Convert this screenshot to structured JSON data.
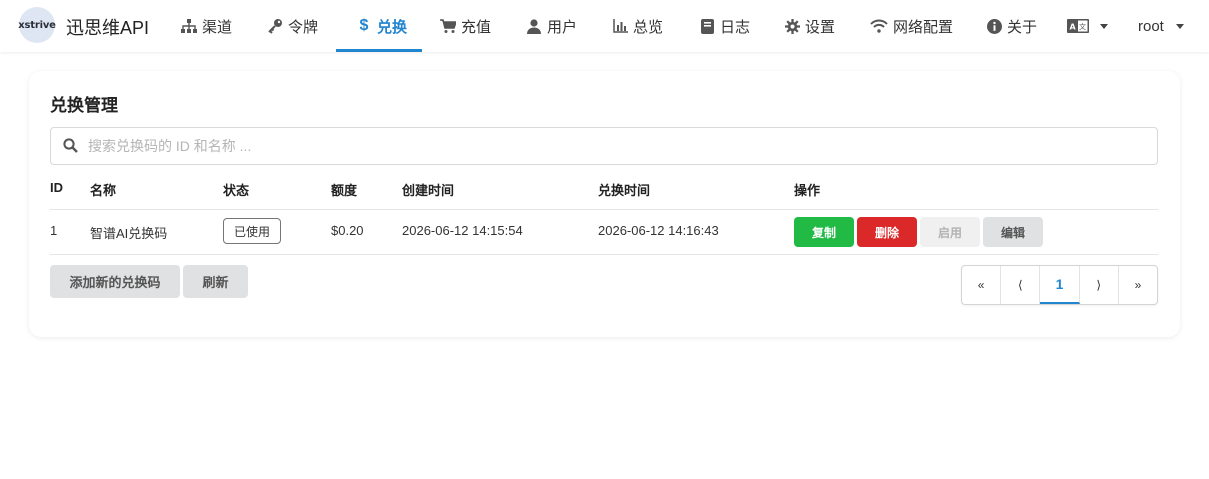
{
  "app": {
    "logo_text": "xstrive",
    "brand": "迅思维API"
  },
  "nav": {
    "items": [
      {
        "label": "渠道",
        "icon": "sitemap-icon"
      },
      {
        "label": "令牌",
        "icon": "key-icon"
      },
      {
        "label": "兑换",
        "icon": "dollar-icon",
        "active": true
      },
      {
        "label": "充值",
        "icon": "cart-icon"
      },
      {
        "label": "用户",
        "icon": "user-icon"
      },
      {
        "label": "总览",
        "icon": "bar-chart-icon"
      },
      {
        "label": "日志",
        "icon": "book-icon"
      },
      {
        "label": "设置",
        "icon": "gear-icon"
      },
      {
        "label": "网络配置",
        "icon": "wifi-icon"
      },
      {
        "label": "关于",
        "icon": "info-icon"
      }
    ],
    "language_icon": "translate-icon",
    "user": "root",
    "accent": "#2185d0"
  },
  "page": {
    "title": "兑换管理",
    "search_placeholder": "搜索兑换码的 ID 和名称 ...",
    "columns": [
      "ID",
      "名称",
      "状态",
      "额度",
      "创建时间",
      "兑换时间",
      "操作"
    ],
    "rows": [
      {
        "id": "1",
        "name": "智谱AI兑换码",
        "status": "已使用",
        "quota": "$0.20",
        "created": "2026-06-12 14:15:54",
        "redeemed": "2026-06-12 14:16:43",
        "actions": {
          "copy": "复制",
          "delete": "删除",
          "enable": "启用",
          "edit": "编辑"
        }
      }
    ],
    "add_button": "添加新的兑换码",
    "refresh_button": "刷新",
    "pagination": {
      "first": "«",
      "prev": "⟨",
      "current": "1",
      "next": "⟩",
      "last": "»"
    }
  },
  "colors": {
    "green": "#21ba45",
    "red": "#db2828",
    "grey": "#e0e1e2"
  }
}
